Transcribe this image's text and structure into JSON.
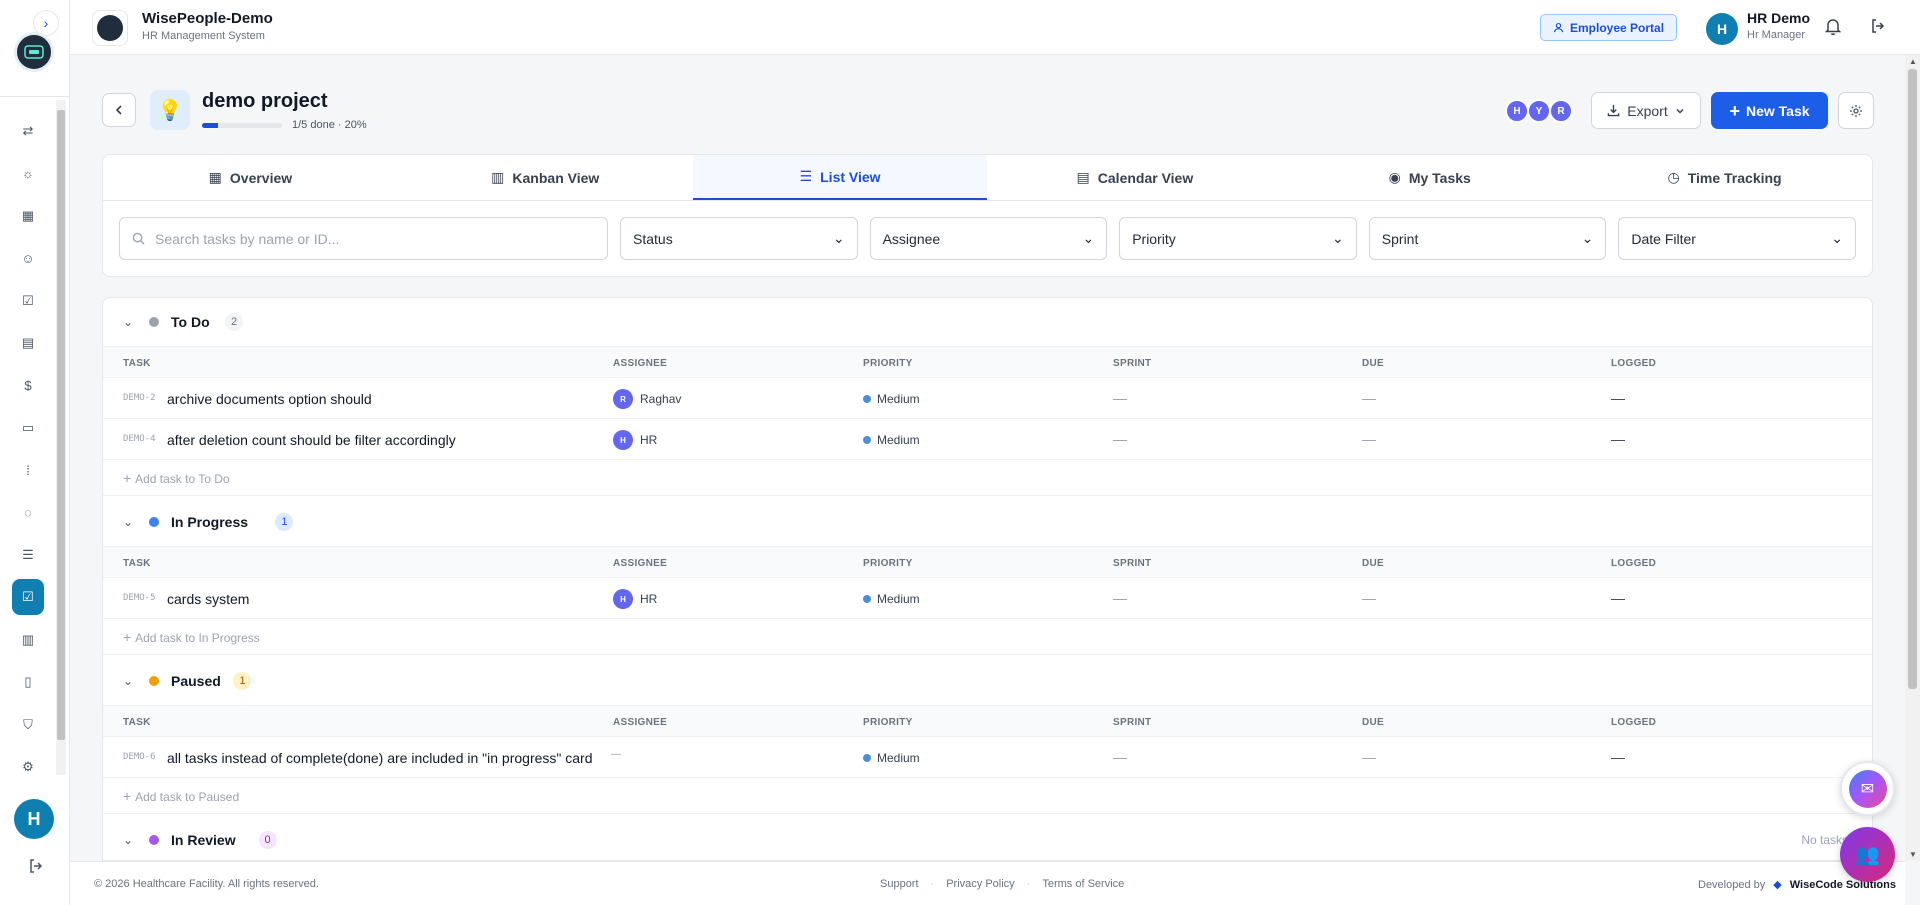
{
  "header": {
    "app_title": "WisePeople-Demo",
    "app_subtitle": "HR Management System",
    "portal_button": "Employee Portal",
    "user_initial": "H",
    "user_name": "HR Demo",
    "user_role": "Hr Manager"
  },
  "sidebar": {
    "user_initial": "H",
    "items": [
      {
        "icon": "users-switch-icon"
      },
      {
        "icon": "lightbulb-icon"
      },
      {
        "icon": "dashboard-grid-icon"
      },
      {
        "icon": "employees-icon"
      },
      {
        "icon": "clipboard-check-icon"
      },
      {
        "icon": "calendar-icon"
      },
      {
        "icon": "dollar-icon"
      },
      {
        "icon": "money-icon"
      },
      {
        "icon": "grid-dots-icon"
      },
      {
        "icon": "chat-icon"
      },
      {
        "icon": "clipboard-list-icon"
      },
      {
        "icon": "tasks-icon",
        "active": true
      },
      {
        "icon": "bar-chart-icon"
      },
      {
        "icon": "document-icon"
      },
      {
        "icon": "shield-icon"
      },
      {
        "icon": "gear-icon"
      }
    ]
  },
  "project": {
    "title": "demo project",
    "progress_text": "1/5 done · 20%",
    "progress_fraction": 0.2,
    "members": [
      "H",
      "Y",
      "R"
    ],
    "export_label": "Export",
    "new_task_label": "New Task"
  },
  "tabs": [
    {
      "label": "Overview",
      "icon": "overview-icon"
    },
    {
      "label": "Kanban View",
      "icon": "kanban-icon"
    },
    {
      "label": "List View",
      "icon": "list-icon",
      "active": true
    },
    {
      "label": "Calendar View",
      "icon": "calendar-icon"
    },
    {
      "label": "My Tasks",
      "icon": "check-circle-icon"
    },
    {
      "label": "Time Tracking",
      "icon": "clock-icon"
    }
  ],
  "filters": {
    "search_placeholder": "Search tasks by name or ID...",
    "status": "Status",
    "assignee": "Assignee",
    "priority": "Priority",
    "sprint": "Sprint",
    "date": "Date Filter"
  },
  "columns": {
    "task": "TASK",
    "assignee": "ASSIGNEE",
    "priority": "PRIORITY",
    "sprint": "SPRINT",
    "due": "DUE",
    "logged": "LOGGED"
  },
  "groups": [
    {
      "name": "To Do",
      "count": "2",
      "color": "#9ca3af",
      "add_label": "Add task to To Do",
      "tasks": [
        {
          "id": "DEMO-2",
          "title": "archive documents option should",
          "assignee_initial": "R",
          "assignee": "Raghav",
          "priority": "Medium",
          "sprint": "—",
          "due": "—",
          "logged": "—"
        },
        {
          "id": "DEMO-4",
          "title": "after deletion count should be filter accordingly",
          "assignee_initial": "H",
          "assignee": "HR",
          "priority": "Medium",
          "sprint": "—",
          "due": "—",
          "logged": "—"
        }
      ]
    },
    {
      "name": "In Progress",
      "count": "1",
      "color": "#3b82f6",
      "add_label": "Add task to In Progress",
      "tasks": [
        {
          "id": "DEMO-5",
          "title": "cards system",
          "assignee_initial": "H",
          "assignee": "HR",
          "priority": "Medium",
          "sprint": "—",
          "due": "—",
          "logged": "—"
        }
      ]
    },
    {
      "name": "Paused",
      "count": "1",
      "color": "#f59e0b",
      "add_label": "Add task to Paused",
      "tasks": [
        {
          "id": "DEMO-6",
          "title": "all tasks instead of complete(done) are included in \"in progress\" card",
          "assignee_initial": "",
          "assignee": "—",
          "priority": "Medium",
          "sprint": "—",
          "due": "—",
          "logged": "—"
        }
      ]
    },
    {
      "name": "In Review",
      "count": "0",
      "color": "#a855f7",
      "empty_label": "No tasks"
    }
  ],
  "footer": {
    "copyright": "© 2026 Healthcare Facility. All rights reserved.",
    "support": "Support",
    "privacy": "Privacy Policy",
    "terms": "Terms of Service",
    "developed_by": "Developed by",
    "company": "WiseCode Solutions"
  }
}
